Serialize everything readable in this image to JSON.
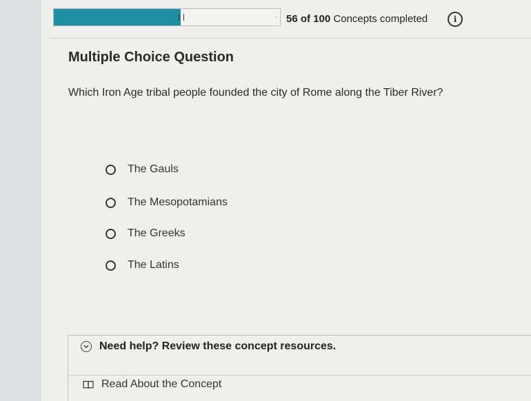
{
  "progress": {
    "completed": 56,
    "total": 100,
    "fraction": 0.56,
    "count_label": "56 of 100",
    "suffix_label": "Concepts completed",
    "fill_color": "#1f8fa6"
  },
  "info_icon": "info-icon",
  "question": {
    "type_label": "Multiple Choice Question",
    "text": "Which Iron Age tribal people founded the city of Rome along the Tiber River?",
    "options": [
      {
        "label": "The Gauls",
        "selected": false
      },
      {
        "label": "The Mesopotamians",
        "selected": false
      },
      {
        "label": "The Greeks",
        "selected": false
      },
      {
        "label": "The Latins",
        "selected": false
      }
    ]
  },
  "help": {
    "toggle_label": "Need help? Review these concept resources.",
    "toggle_icon": "chevron-down-circle-icon",
    "resource_label": "Read About the Concept",
    "resource_icon": "book-icon"
  }
}
